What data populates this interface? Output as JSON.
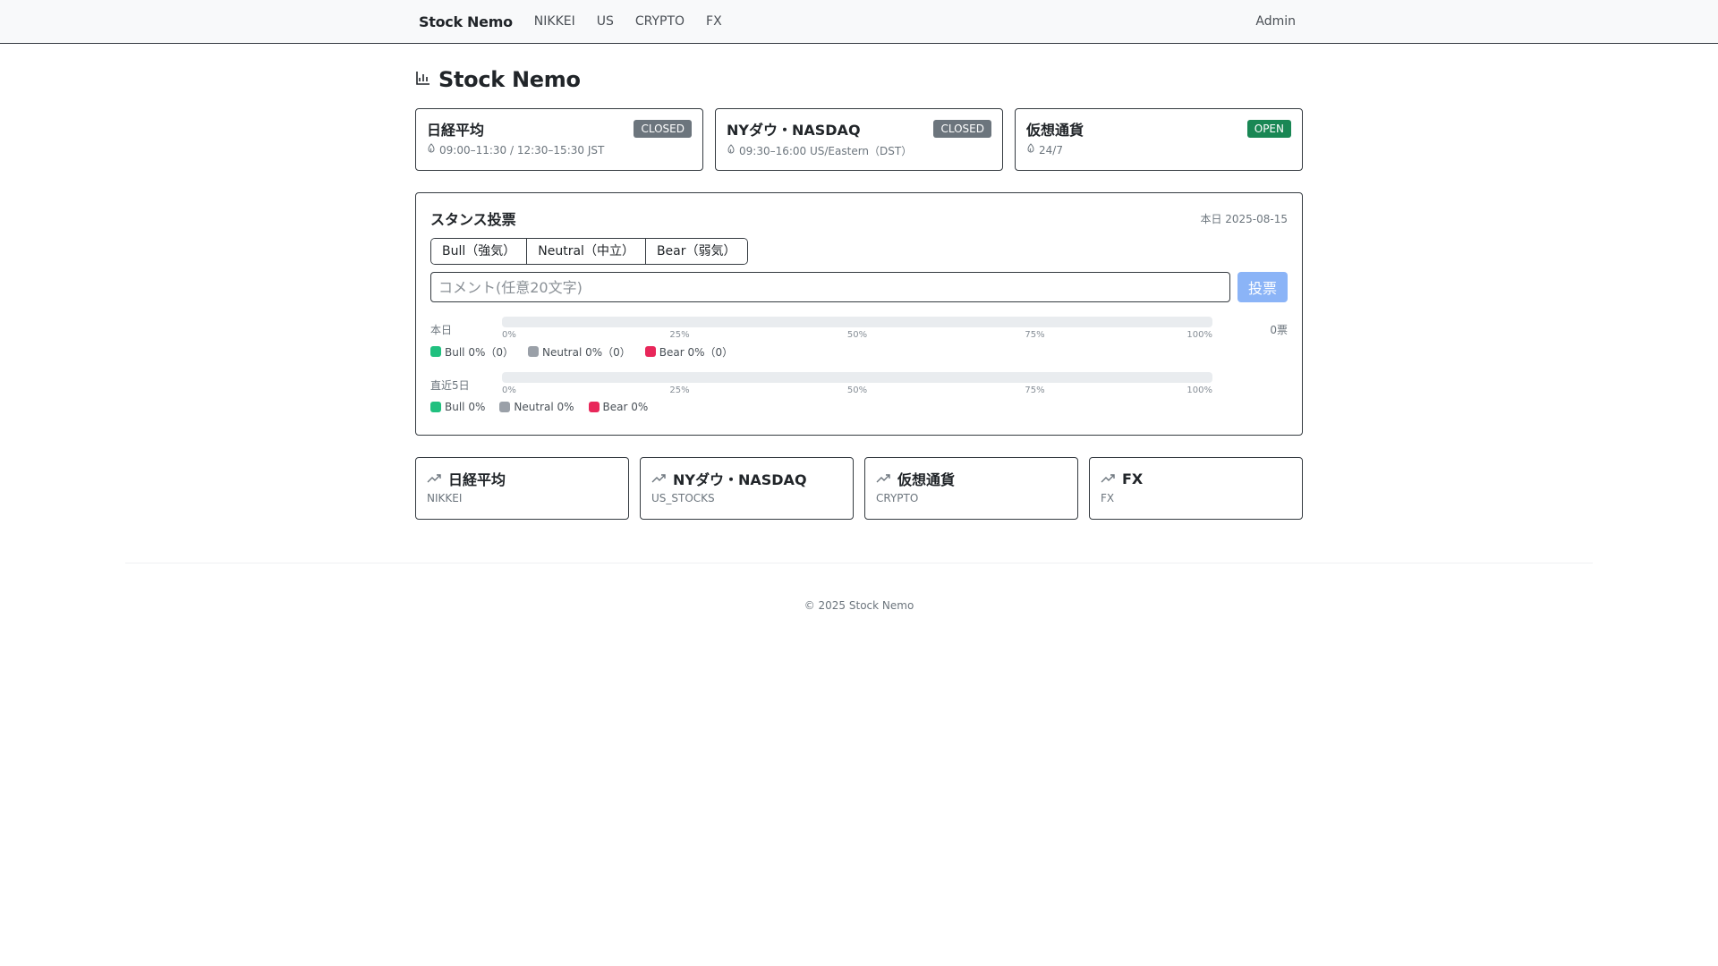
{
  "nav": {
    "brand": "Stock Nemo",
    "links": [
      "NIKKEI",
      "US",
      "CRYPTO",
      "FX"
    ],
    "admin": "Admin"
  },
  "page": {
    "title": "Stock Nemo"
  },
  "markets": [
    {
      "name": "日経平均",
      "status": "CLOSED",
      "hours": "09:00–11:30 / 12:30–15:30 JST"
    },
    {
      "name": "NYダウ・NASDAQ",
      "status": "CLOSED",
      "hours": "09:30–16:00 US/Eastern（DST）"
    },
    {
      "name": "仮想通貨",
      "status": "OPEN",
      "hours": "24/7"
    }
  ],
  "vote": {
    "title": "スタンス投票",
    "date": "本日 2025-08-15",
    "options": [
      "Bull（強気）",
      "Neutral（中立）",
      "Bear（弱気）"
    ],
    "placeholder": "コメント(任意20文字)",
    "submit": "投票",
    "ticks": [
      "0%",
      "25%",
      "50%",
      "75%",
      "100%"
    ],
    "today": {
      "label": "本日",
      "count": "0票",
      "bull_pct": 0,
      "neutral_pct": 0,
      "bear_pct": 0,
      "legend": [
        "Bull 0%（0）",
        "Neutral 0%（0）",
        "Bear 0%（0）"
      ]
    },
    "recent": {
      "label": "直近5日",
      "bull_pct": 0,
      "neutral_pct": 0,
      "bear_pct": 0,
      "legend": [
        "Bull 0%",
        "Neutral 0%",
        "Bear 0%"
      ]
    },
    "colors": {
      "bull": "#20c07f",
      "neutral": "#9aa0a8",
      "bear": "#e8275a"
    }
  },
  "links": [
    {
      "name": "日経平均",
      "code": "NIKKEI"
    },
    {
      "name": "NYダウ・NASDAQ",
      "code": "US_STOCKS"
    },
    {
      "name": "仮想通貨",
      "code": "CRYPTO"
    },
    {
      "name": "FX",
      "code": "FX"
    }
  ],
  "footer": "© 2025 Stock Nemo"
}
